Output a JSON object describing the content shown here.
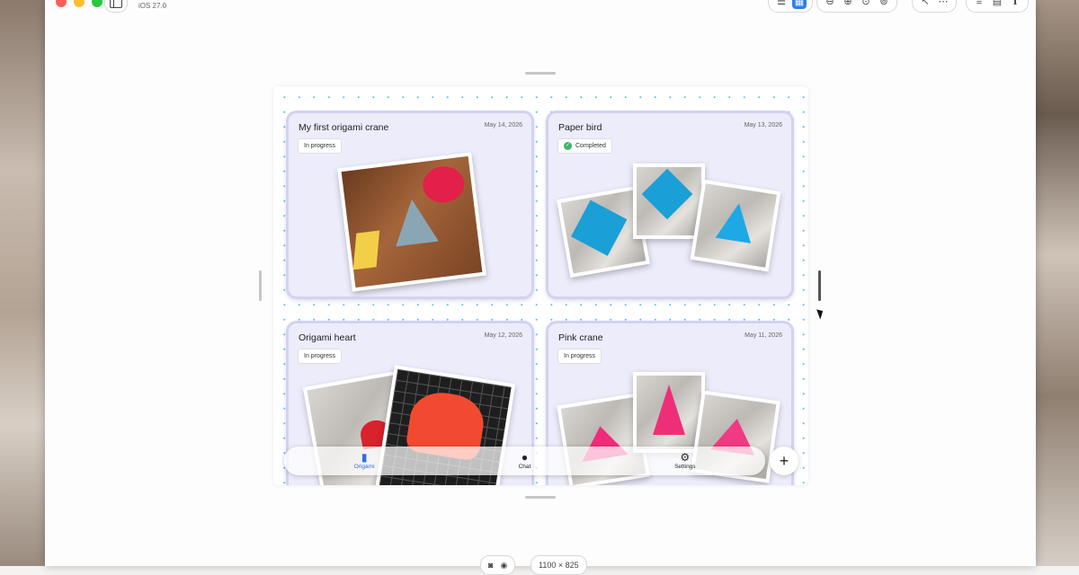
{
  "window": {
    "os_version": "iOS 27.0",
    "toolbar": {
      "layout_icons": [
        "list-view-icon",
        "grid-view-icon"
      ],
      "zoom_icons": [
        "zoom-out-icon",
        "zoom-in-icon",
        "zoom-fit-icon",
        "zoom-actual-icon"
      ],
      "more_icons": [
        "pointer-icon",
        "more-icon"
      ],
      "right_icons": [
        "settings-sliders-icon",
        "document-icon",
        "info-icon"
      ]
    }
  },
  "app": {
    "cards": [
      {
        "title": "My first origami crane",
        "date": "May 14, 2026",
        "status": "In progress",
        "completed": false
      },
      {
        "title": "Paper bird",
        "date": "May 13, 2026",
        "status": "Completed",
        "completed": true
      },
      {
        "title": "Origami heart",
        "date": "May 12, 2026",
        "status": "In progress",
        "completed": false
      },
      {
        "title": "Pink crane",
        "date": "May 11, 2026",
        "status": "In progress",
        "completed": false
      }
    ],
    "tabbar": {
      "tabs": [
        {
          "label": "Origami",
          "icon": "book-icon",
          "active": true
        },
        {
          "label": "Chat",
          "icon": "chat-bubble-icon",
          "active": false
        },
        {
          "label": "Settings",
          "icon": "gear-icon",
          "active": false
        }
      ],
      "add_label": "+"
    }
  },
  "bottom_bar": {
    "size_text": "1100 × 825"
  },
  "colors": {
    "accent": "#2b6fe0",
    "card_bg": "#ececfb",
    "card_border": "#d2d2f2",
    "completed": "#39b86b",
    "paper_blue": "#1a9fd6",
    "paper_pink": "#f02c7a",
    "paper_red": "#f24a30"
  }
}
